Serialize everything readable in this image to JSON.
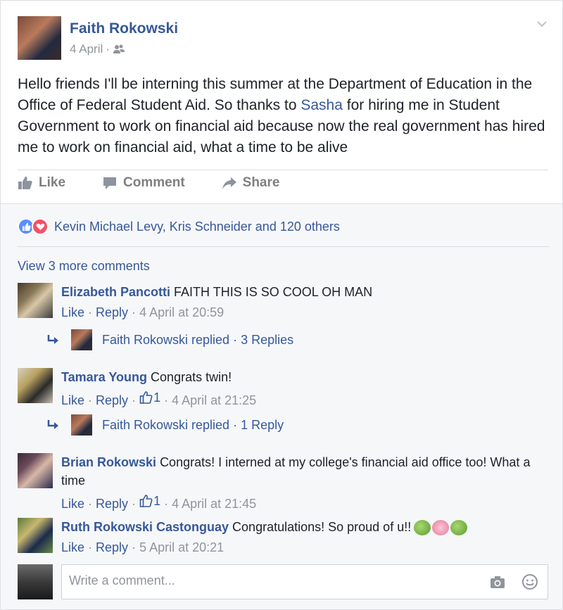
{
  "post": {
    "author": "Faith Rokowski",
    "date": "4 April",
    "date_sep": " · ",
    "text_before": "Hello friends I'll be interning this summer at the Department of Education in the Office of Federal Student Aid. So thanks to ",
    "text_link": "Sasha",
    "text_after": " for hiring me in Student Government to work on financial aid because now the real government has hired me to work on financial aid, what a time to be alive"
  },
  "actions": {
    "like": "Like",
    "comment": "Comment",
    "share": "Share"
  },
  "reactions": {
    "summary": "Kevin Michael Levy, Kris Schneider and 120 others"
  },
  "view_more": "View 3 more comments",
  "comments": [
    {
      "name": "Elizabeth Pancotti",
      "text": "FAITH THIS IS SO COOL OH MAN",
      "like": "Like",
      "reply": "Reply",
      "likes": "",
      "time": "4 April at 20:59",
      "replies_text": "Faith Rokowski replied · 3 Replies"
    },
    {
      "name": "Tamara Young",
      "text": "Congrats twin!",
      "like": "Like",
      "reply": "Reply",
      "likes": "1",
      "time": "4 April at 21:25",
      "replies_text": "Faith Rokowski replied · 1 Reply"
    },
    {
      "name": "Brian Rokowski",
      "text": "Congrats! I interned at my college's financial aid office too! What a time",
      "like": "Like",
      "reply": "Reply",
      "likes": "1",
      "time": "4 April at 21:45"
    },
    {
      "name": "Ruth Rokowski Castonguay",
      "text": "Congratulations! So proud of u!!",
      "like": "Like",
      "reply": "Reply",
      "likes": "",
      "time": "5 April at 20:21"
    }
  ],
  "composer": {
    "placeholder": "Write a comment..."
  },
  "colors": {
    "link": "#365899",
    "meta": "#90949c",
    "like_reaction": "#5890ff",
    "love_reaction": "#f25268"
  }
}
